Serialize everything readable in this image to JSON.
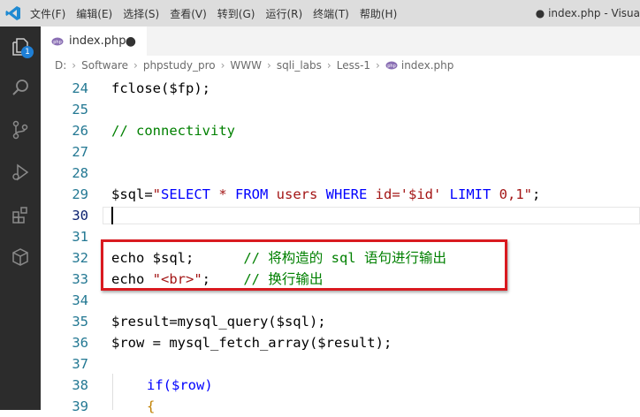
{
  "menu": {
    "items": [
      "文件(F)",
      "编辑(E)",
      "选择(S)",
      "查看(V)",
      "转到(G)",
      "运行(R)",
      "终端(T)",
      "帮助(H)"
    ],
    "window_title": "● index.php - Visua"
  },
  "activity": {
    "explorer_badge": "1",
    "icons": [
      "explorer-icon",
      "search-icon",
      "source-control-icon",
      "run-debug-icon",
      "extensions-icon",
      "remote-box-icon"
    ]
  },
  "tab": {
    "label": "index.php",
    "dirty_marker": "●"
  },
  "breadcrumb": {
    "parts": [
      "D:",
      "Software",
      "phpstudy_pro",
      "WWW",
      "sqli_labs",
      "Less-1",
      "index.php"
    ]
  },
  "editor": {
    "line_numbers": [
      "24",
      "25",
      "26",
      "27",
      "28",
      "29",
      "30",
      "31",
      "32",
      "33",
      "34",
      "35",
      "36",
      "37",
      "38",
      "39"
    ],
    "lines": {
      "l24": "fclose($fp);",
      "l26": "// connectivity",
      "l29_a": "$sql=",
      "l29_b": "\"",
      "l29_c": "SELECT",
      "l29_d": " * ",
      "l29_e": "FROM",
      "l29_f": " users ",
      "l29_g": "WHERE",
      "l29_h": " id='$id' ",
      "l29_i": "LIMIT",
      "l29_j": " 0,1\"",
      "l29_k": ";",
      "l32_code": "echo $sql;      ",
      "l32_comment": "// 将构造的 sql 语句进行输出",
      "l33_a": "echo ",
      "l33_b": "\"<br>\"",
      "l33_c": ";    ",
      "l33_comment": "// 换行输出",
      "l35": "$result=mysql_query($sql);",
      "l36": "$row = mysql_fetch_array($result);",
      "l38": "if($row)",
      "l39": "{"
    }
  },
  "colors": {
    "keyword": "#0000ff",
    "string": "#a31515",
    "comment": "#008000",
    "line_number": "#237893",
    "highlight_box": "#d91a20"
  }
}
